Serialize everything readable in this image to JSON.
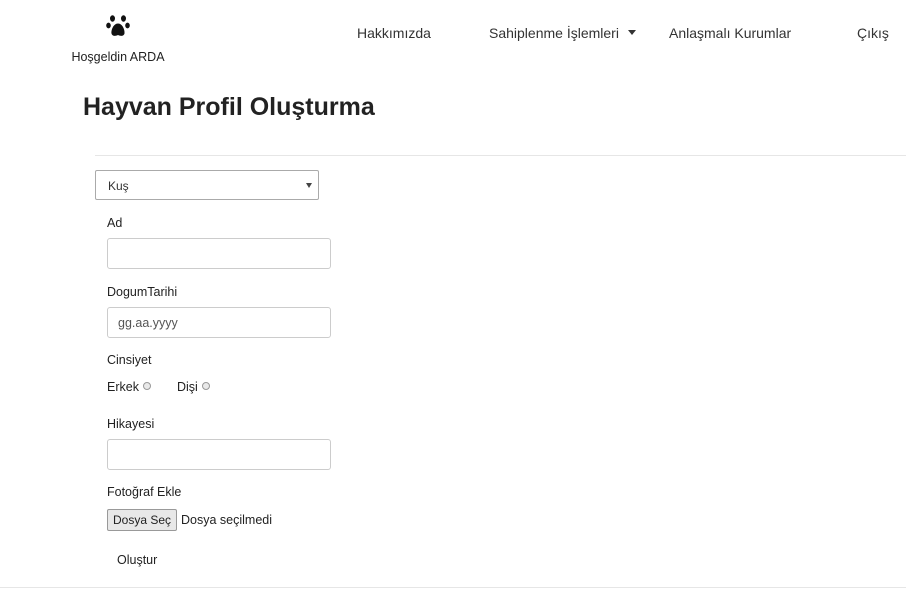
{
  "header": {
    "welcome_text": "Hoşgeldin ARDA",
    "logo_icon": "paw-icon",
    "nav": {
      "about": "Hakkımızda",
      "adoption": "Sahiplenme İşlemleri",
      "partners": "Anlaşmalı Kurumlar",
      "logout": "Çıkış"
    }
  },
  "page": {
    "title": "Hayvan Profil Oluşturma"
  },
  "form": {
    "animal_type": {
      "selected": "Kuş"
    },
    "name": {
      "label": "Ad",
      "value": ""
    },
    "birth_date": {
      "label": "DogumTarihi",
      "placeholder": "gg.aa.yyyy"
    },
    "gender": {
      "label": "Cinsiyet",
      "options": [
        "Erkek",
        "Dişi"
      ]
    },
    "story": {
      "label": "Hikayesi",
      "value": ""
    },
    "photo": {
      "label": "Fotoğraf Ekle",
      "button": "Dosya Seç",
      "status": "Dosya seçilmedi"
    },
    "submit_label": "Oluştur"
  }
}
